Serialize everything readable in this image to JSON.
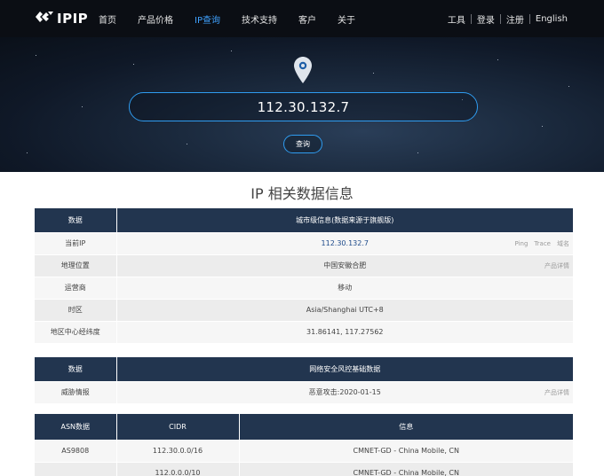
{
  "brand": {
    "name": "IPIP"
  },
  "nav": {
    "items": [
      {
        "label": "首页",
        "active": false
      },
      {
        "label": "产品价格",
        "active": false
      },
      {
        "label": "IP查询",
        "active": true
      },
      {
        "label": "技术支持",
        "active": false
      },
      {
        "label": "客户",
        "active": false
      },
      {
        "label": "关于",
        "active": false
      }
    ],
    "right": [
      "工具",
      "登录",
      "注册",
      "English"
    ]
  },
  "search": {
    "value": "112.30.132.7",
    "button_label": "查询"
  },
  "page_title": "IP 相关数据信息",
  "city_table": {
    "header": [
      "数据",
      "城市级信息(数据来源于旗舰版)"
    ],
    "rows": [
      {
        "label": "当前IP",
        "value": "112.30.132.7",
        "links": [
          "Ping",
          "Trace",
          "域名"
        ]
      },
      {
        "label": "地理位置",
        "value": "中国安徽合肥",
        "links": [
          "产品详情"
        ]
      },
      {
        "label": "运营商",
        "value": "移动",
        "links": []
      },
      {
        "label": "时区",
        "value": "Asia/Shanghai UTC+8",
        "links": []
      },
      {
        "label": "地区中心经纬度",
        "value": "31.86141, 117.27562",
        "links": []
      }
    ]
  },
  "risk_table": {
    "header": [
      "数据",
      "网络安全风控基础数据"
    ],
    "rows": [
      {
        "label": "威胁情报",
        "value": "恶意攻击:2020-01-15",
        "links": [
          "产品详情"
        ]
      }
    ]
  },
  "asn_table": {
    "header": [
      "ASN数据",
      "CIDR",
      "信息"
    ],
    "rows": [
      {
        "asn": "AS9808",
        "cidr": "112.30.0.0/16",
        "info": "CMNET-GD - China Mobile, CN"
      },
      {
        "asn": "",
        "cidr": "112.0.0.0/10",
        "info": "CMNET-GD - China Mobile, CN"
      }
    ]
  },
  "colors": {
    "accent": "#2f9cf0",
    "nav_active": "#3fa2ff",
    "table_header": "#22354f",
    "topbar": "#0b0e14"
  }
}
